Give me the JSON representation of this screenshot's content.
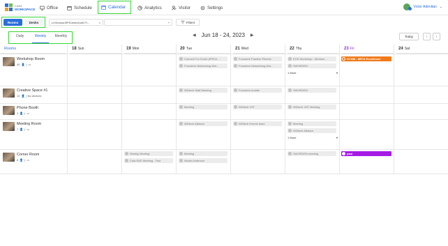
{
  "brand": {
    "line1": "CANS",
    "line2": "WORKSPACE"
  },
  "nav": [
    {
      "label": "Office",
      "icon": "monitor-icon"
    },
    {
      "label": "Schedule",
      "icon": "calendar-small-icon"
    },
    {
      "label": "Calendar",
      "icon": "calendar-icon"
    },
    {
      "label": "Analytics",
      "icon": "pie-chart-icon"
    },
    {
      "label": "Visitor",
      "icon": "visitor-icon"
    },
    {
      "label": "Settings",
      "icon": "gear-icon"
    }
  ],
  "user": {
    "name": "Victor Adenitan"
  },
  "filterbar": {
    "segments": [
      "Rooms",
      "Desks"
    ],
    "path": "LIV/Indoor/EPICenter/Unit Fl...",
    "filters_label": "Filters"
  },
  "view_tabs": [
    "Daily",
    "Weekly",
    "Monthly"
  ],
  "range_label": "Jun 18 - 24, 2023",
  "today_label": "Today",
  "columns": {
    "rooms_header": "Rooms",
    "days": [
      {
        "num": "18",
        "dow": "Sun"
      },
      {
        "num": "19",
        "dow": "Mon"
      },
      {
        "num": "20",
        "dow": "Tue"
      },
      {
        "num": "21",
        "dow": "Wed"
      },
      {
        "num": "22",
        "dow": "Thu"
      },
      {
        "num": "23",
        "dow": "Fri"
      },
      {
        "num": "24",
        "dow": "Sat"
      }
    ]
  },
  "rooms": [
    {
      "name": "Workshop Room",
      "cap": "40",
      "extra": "|"
    },
    {
      "name": "Creative Space #1",
      "cap": "12",
      "extra": "| No devices"
    },
    {
      "name": "Phone Booth",
      "cap": "2",
      "extra": "|"
    },
    {
      "name": "Meeting Room",
      "cap": "7",
      "extra": "|"
    },
    {
      "name": "Corner Room",
      "cap": "6",
      "extra": "|"
    }
  ],
  "events": {
    "r0_tue_1": "Connect For Event (EPICe...",
    "r0_tue_2": "Founders Networking Wor...",
    "r0_wed_1": "Founders Practice Pitches",
    "r0_wed_2": "Founders Networking Wor...",
    "r0_thu_1": "EOS Workshop - Medium ...",
    "r0_thu_2": "SWORDEN",
    "r0_fri_1": "00 MM - META Excellence",
    "r1_tue_1": "WDtech Staff Meeting",
    "r1_wed_1": "Founders huddle",
    "r1_thu_1": "SWORDEN",
    "r2_tue_1": "Meeting",
    "r2_wed_1": "WDtech VST",
    "r2_thu_1": "WDtech VST Meeting",
    "r3_tue_1": "WDtech Alliance",
    "r3_wed_1": "WDtech Events team",
    "r3_thu_1": "Meeting",
    "r3_thu_2": "WDtech Alliance",
    "r4_mon_1": "Weekly Meeting",
    "r4_mon_2": "Cola R&D Meeting - Test",
    "r4_tue_1": "Meeting",
    "r4_tue_2": "Nicole Anderson",
    "r4_thu_1": "SWORDEN meeting",
    "r4_fri_1": "paul"
  },
  "more_label": "1 More",
  "colors": {
    "accent": "#2a6fdb",
    "highlight": "#33d633",
    "orange": "#f07a1a",
    "purple": "#a61ae6"
  }
}
